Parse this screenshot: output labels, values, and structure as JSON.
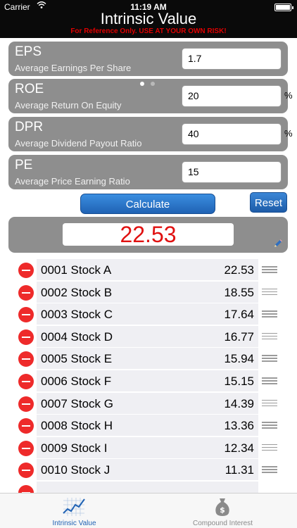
{
  "status_bar": {
    "carrier": "Carrier",
    "time": "11:19 AM"
  },
  "nav": {
    "title": "Intrinsic Value",
    "warning": "For Reference Only. USE AT YOUR OWN RISK!"
  },
  "inputs": [
    {
      "title": "EPS",
      "subtitle": "Average Earnings Per Share",
      "value": "1.7",
      "unit": ""
    },
    {
      "title": "ROE",
      "subtitle": "Average Return On Equity",
      "value": "20",
      "unit": "%"
    },
    {
      "title": "DPR",
      "subtitle": "Average Dividend Payout Ratio",
      "value": "40",
      "unit": "%"
    },
    {
      "title": "PE",
      "subtitle": "Average Price Earning Ratio",
      "value": "15",
      "unit": ""
    }
  ],
  "buttons": {
    "calculate": "Calculate",
    "reset": "Reset"
  },
  "result": {
    "value": "22.53"
  },
  "stocks": [
    {
      "name": "0001 Stock A",
      "value": "22.53"
    },
    {
      "name": "0002 Stock B",
      "value": "18.55"
    },
    {
      "name": "0003 Stock C",
      "value": "17.64"
    },
    {
      "name": "0004 Stock D",
      "value": "16.77"
    },
    {
      "name": "0005 Stock E",
      "value": "15.94"
    },
    {
      "name": "0006 Stock F",
      "value": "15.15"
    },
    {
      "name": "0007 Stock G",
      "value": "14.39"
    },
    {
      "name": "0008 Stock H",
      "value": "13.36"
    },
    {
      "name": "0009 Stock I",
      "value": "12.34"
    },
    {
      "name": "0010 Stock J",
      "value": "11.31"
    }
  ],
  "tabs": [
    {
      "label": "Intrinsic Value",
      "icon": "chart-icon",
      "active": true
    },
    {
      "label": "Compound Interest",
      "icon": "money-bag-icon",
      "active": false
    }
  ],
  "colors": {
    "accent": "#1f62b4",
    "result_text": "#e01010",
    "warning": "#e00000",
    "delete": "#ee2a2a",
    "card_bg": "#8e8e8e"
  }
}
